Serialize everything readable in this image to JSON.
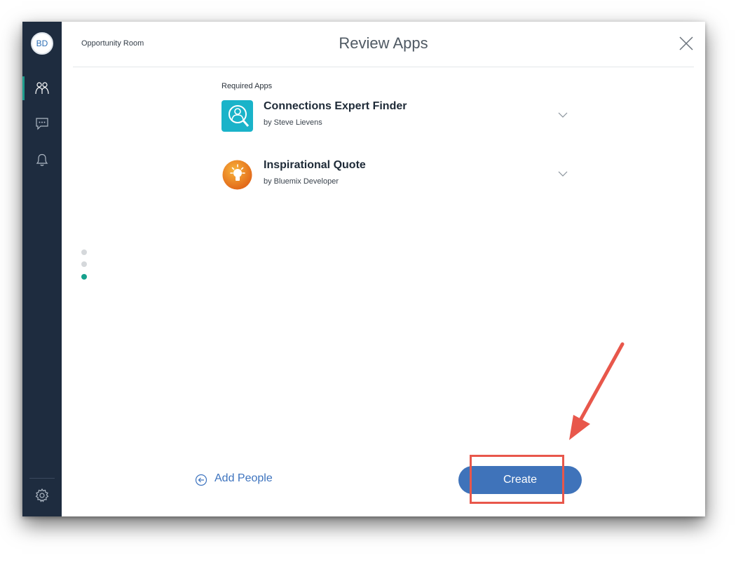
{
  "sidebar": {
    "avatar_initials": "BD",
    "nav": [
      {
        "icon": "people-icon",
        "active": true
      },
      {
        "icon": "chat-icon",
        "active": false
      },
      {
        "icon": "bell-icon",
        "active": false
      }
    ],
    "footer_icon": "gear-icon"
  },
  "header": {
    "room_name": "Opportunity Room",
    "title": "Review Apps",
    "close_icon": "close-icon"
  },
  "required_apps": {
    "label": "Required Apps",
    "apps": [
      {
        "name": "Connections Expert Finder",
        "author": "by Steve Lievens",
        "icon": "expert-finder-icon",
        "icon_color": "#1ab3c9"
      },
      {
        "name": "Inspirational Quote",
        "author": "by Bluemix Developer",
        "icon": "lightbulb-icon",
        "icon_color": "#f08c1e"
      }
    ]
  },
  "steps": {
    "total": 3,
    "current": 3
  },
  "footer": {
    "back_label": "Add People",
    "create_label": "Create"
  },
  "colors": {
    "sidebar_bg": "#1e2c3f",
    "accent_teal": "#16a18d",
    "primary_blue": "#3f73ba",
    "annotation_red": "#e8574b"
  }
}
